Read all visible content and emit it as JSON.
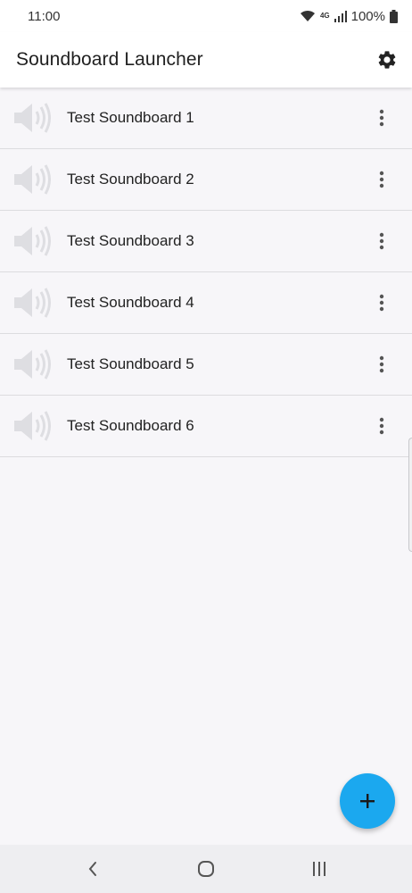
{
  "status_bar": {
    "time": "11:00",
    "network_type": "4G",
    "battery_percent": "100%",
    "icons": [
      "wifi-icon",
      "signal-icon",
      "battery-icon"
    ]
  },
  "app_bar": {
    "title": "Soundboard Launcher",
    "settings_icon": "gear-icon"
  },
  "soundboards": [
    {
      "label": "Test Soundboard 1",
      "icon": "speaker-icon",
      "menu_icon": "more-vert-icon"
    },
    {
      "label": "Test Soundboard 2",
      "icon": "speaker-icon",
      "menu_icon": "more-vert-icon"
    },
    {
      "label": "Test Soundboard 3",
      "icon": "speaker-icon",
      "menu_icon": "more-vert-icon"
    },
    {
      "label": "Test Soundboard 4",
      "icon": "speaker-icon",
      "menu_icon": "more-vert-icon"
    },
    {
      "label": "Test Soundboard 5",
      "icon": "speaker-icon",
      "menu_icon": "more-vert-icon"
    },
    {
      "label": "Test Soundboard 6",
      "icon": "speaker-icon",
      "menu_icon": "more-vert-icon"
    }
  ],
  "fab": {
    "icon": "plus-icon",
    "color": "#1ba8ef"
  },
  "nav_bar": {
    "icons": [
      "back-icon",
      "home-icon",
      "recents-icon"
    ]
  },
  "colors": {
    "background": "#f7f6f9",
    "app_bar": "#ffffff",
    "accent": "#1ba8ef",
    "speaker_icon": "#dedee2",
    "divider": "#dcdcdf"
  }
}
